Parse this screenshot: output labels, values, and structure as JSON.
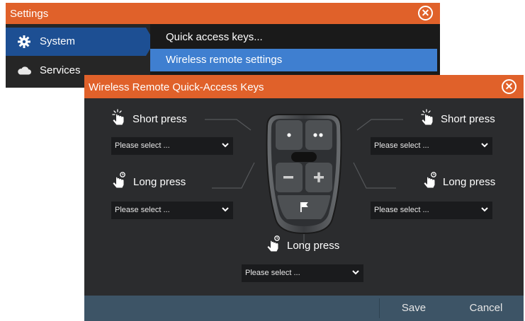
{
  "settings": {
    "title": "Settings",
    "sidebar": [
      {
        "label": "System",
        "icon": "gear-icon"
      },
      {
        "label": "Services",
        "icon": "cloud-icon"
      }
    ],
    "menu": [
      {
        "label": "Quick access keys..."
      },
      {
        "label": "Wireless remote settings"
      }
    ]
  },
  "dialog": {
    "title": "Wireless Remote Quick-Access Keys",
    "left_short": {
      "label": "Short press",
      "select": "Please select ..."
    },
    "left_long": {
      "label": "Long press",
      "select": "Please select ..."
    },
    "right_short": {
      "label": "Short press",
      "select": "Please select ..."
    },
    "right_long": {
      "label": "Long press",
      "select": "Please select ..."
    },
    "bottom_long": {
      "label": "Long press",
      "select": "Please select ..."
    },
    "save_label": "Save",
    "cancel_label": "Cancel"
  },
  "colors": {
    "accent": "#e0612a",
    "selection": "#3f7fd0",
    "sidebar_active": "#1d4f93",
    "dialog_bg": "#2b2c2e",
    "footer_bg": "#3d5466"
  }
}
